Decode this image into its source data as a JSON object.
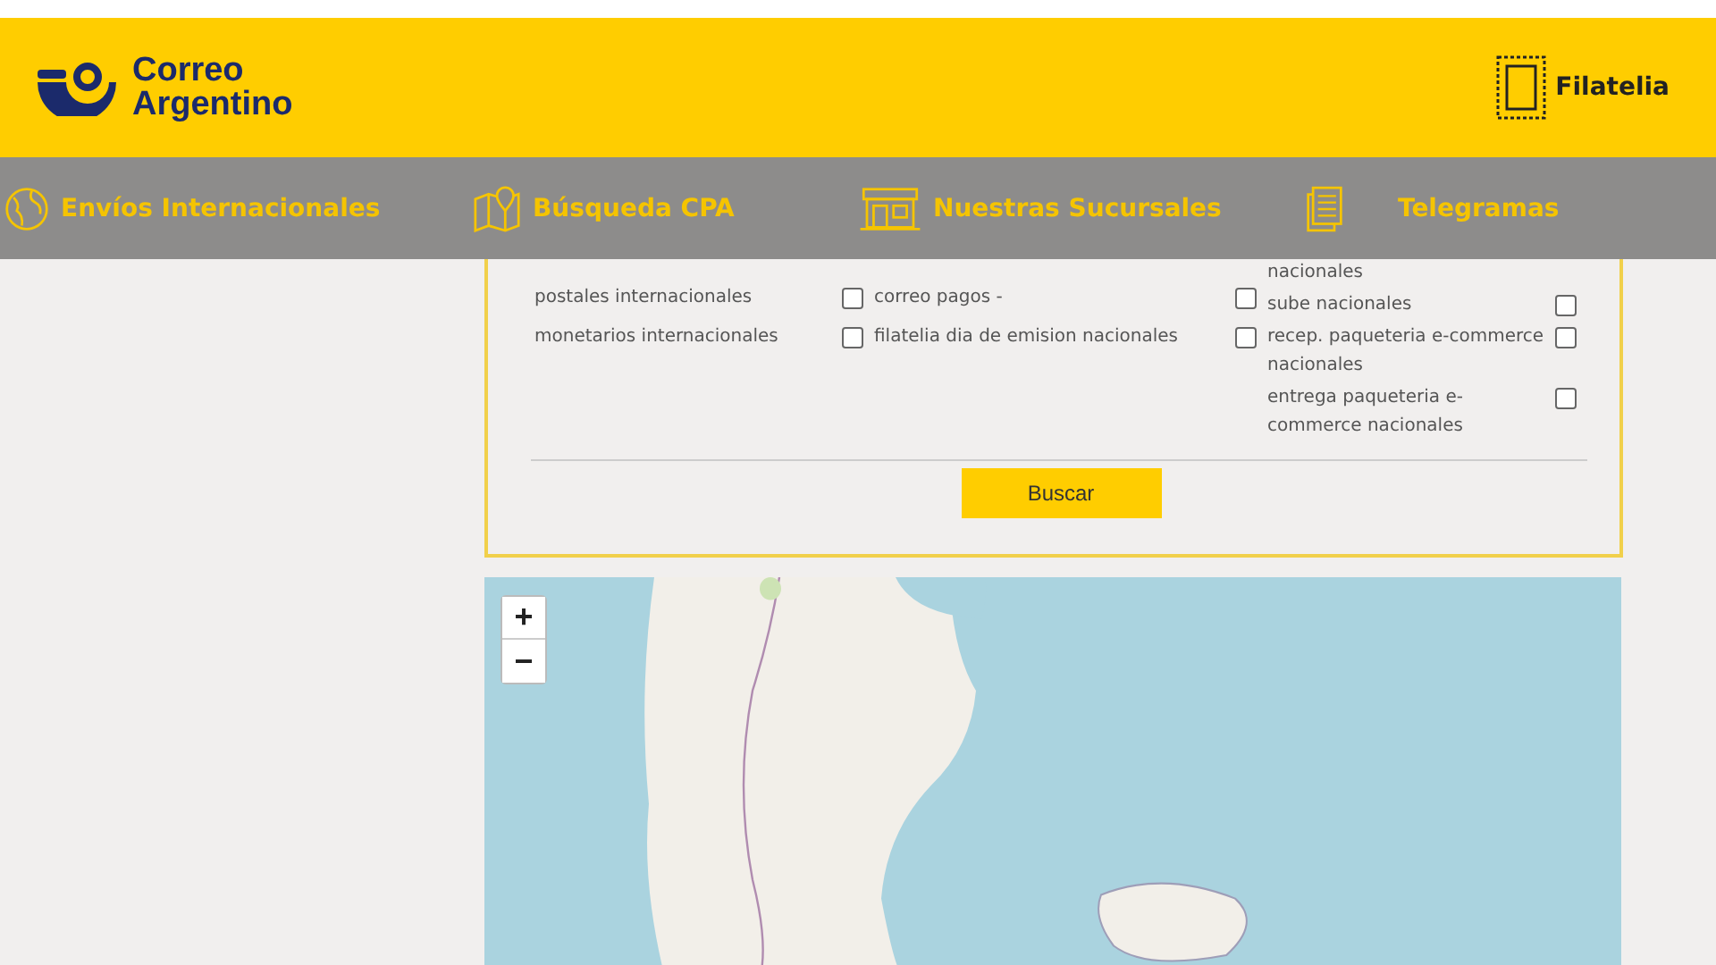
{
  "header": {
    "logo_text": "Correo Argentino",
    "filatelia_link": "Filatelia"
  },
  "nav": [
    {
      "label": "Envíos Internacionales"
    },
    {
      "label": "Búsqueda CPA"
    },
    {
      "label": "Nuestras Sucursales"
    },
    {
      "label": "Telegramas"
    }
  ],
  "filter_columns": [
    [
      {
        "kind": "option",
        "label": "postales internacionales",
        "checked": false
      },
      {
        "kind": "option",
        "label": "monetarios internacionales",
        "checked": false
      }
    ],
    [
      {
        "kind": "option",
        "label": "correo pagos -",
        "checked": false
      },
      {
        "kind": "option",
        "label": "filatelia dia de emision nacionales",
        "checked": false
      }
    ],
    [
      {
        "kind": "continuation",
        "label": "nacionales"
      },
      {
        "kind": "option",
        "label": "sube nacionales",
        "checked": false
      },
      {
        "kind": "option",
        "label": "recep. paqueteria e-commerce nacionales",
        "checked": false
      },
      {
        "kind": "option",
        "label": "entrega paqueteria e-commerce nacionales",
        "checked": false
      }
    ]
  ],
  "search_button": "Buscar",
  "map": {
    "zoom_in": "+",
    "zoom_out": "−"
  }
}
